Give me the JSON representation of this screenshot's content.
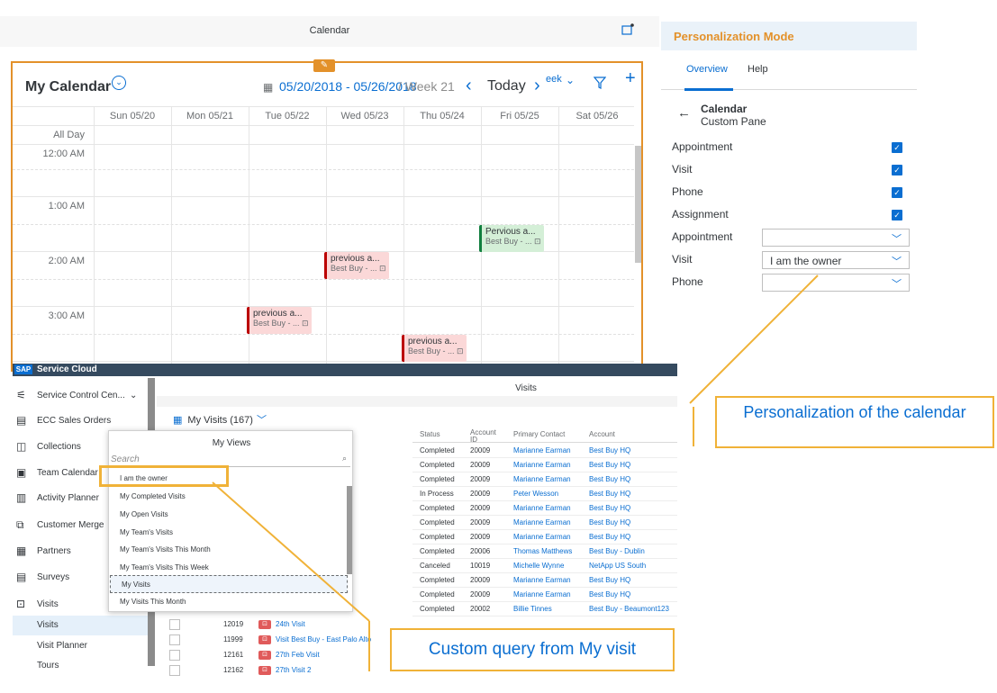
{
  "calendar": {
    "window_title": "Calendar",
    "title": "My Calendar",
    "range": "05/20/2018 - 05/26/2018",
    "week": "/ Week 21",
    "today_label": "Today",
    "view_fragment": "eek",
    "days": [
      "Sun 05/20",
      "Mon 05/21",
      "Tue 05/22",
      "Wed 05/23",
      "Thu 05/24",
      "Fri 05/25",
      "Sat 05/26"
    ],
    "all_day_label": "All Day",
    "times": [
      "12:00 AM",
      "1:00 AM",
      "2:00 AM",
      "3:00 AM"
    ],
    "appointments": [
      {
        "title": "Pervious a...",
        "sub": "Best Buy - ...",
        "color": "green"
      },
      {
        "title": "previous a...",
        "sub": "Best Buy - ...",
        "color": "red"
      },
      {
        "title": "previous a...",
        "sub": "Best Buy - ...",
        "color": "red"
      },
      {
        "title": "previous a...",
        "sub": "Best Buy - ...",
        "color": "red"
      }
    ]
  },
  "personalization": {
    "header": "Personalization Mode",
    "tabs": [
      "Overview",
      "Help"
    ],
    "section_title": "Calendar",
    "section_subtitle": "Custom Pane",
    "checkboxes": [
      "Appointment",
      "Visit",
      "Phone",
      "Assignment"
    ],
    "selects": [
      {
        "label": "Appointment",
        "value": ""
      },
      {
        "label": "Visit",
        "value": "I am the owner"
      },
      {
        "label": "Phone",
        "value": ""
      }
    ]
  },
  "annotations": {
    "personalization": "Personalization of the calendar",
    "query": "Custom query from My visit"
  },
  "service_cloud": {
    "logo": "SAP",
    "product": "Service Cloud",
    "page_title": "Visits",
    "sidebar": [
      "Service Control Cen...",
      "ECC Sales Orders",
      "Collections",
      "Team Calendar",
      "Activity Planner",
      "Customer Merge",
      "Partners",
      "Surveys",
      "Visits"
    ],
    "sidebar_sub": [
      "Visits",
      "Visit Planner",
      "Tours"
    ],
    "view_title": "My Visits (167)",
    "table_headers": [
      "Status",
      "Account ID",
      "Primary Contact",
      "Account"
    ],
    "rows": [
      {
        "status": "Completed",
        "id": "20009",
        "contact": "Marianne Earman",
        "account": "Best Buy HQ"
      },
      {
        "status": "Completed",
        "id": "20009",
        "contact": "Marianne Earman",
        "account": "Best Buy HQ"
      },
      {
        "status": "Completed",
        "id": "20009",
        "contact": "Marianne Earman",
        "account": "Best Buy HQ"
      },
      {
        "status": "In Process",
        "id": "20009",
        "contact": "Peter Wesson",
        "account": "Best Buy HQ"
      },
      {
        "status": "Completed",
        "id": "20009",
        "contact": "Marianne Earman",
        "account": "Best Buy HQ"
      },
      {
        "status": "Completed",
        "id": "20009",
        "contact": "Marianne Earman",
        "account": "Best Buy HQ"
      },
      {
        "status": "Completed",
        "id": "20009",
        "contact": "Marianne Earman",
        "account": "Best Buy HQ"
      },
      {
        "status": "Completed",
        "id": "20006",
        "contact": "Thomas Matthews",
        "account": "Best Buy - Dublin"
      },
      {
        "status": "Canceled",
        "id": "10019",
        "contact": "Michelle Wynne",
        "account": "NetApp US South"
      },
      {
        "status": "Completed",
        "id": "20009",
        "contact": "Marianne Earman",
        "account": "Best Buy HQ"
      },
      {
        "status": "Completed",
        "id": "20009",
        "contact": "Marianne Earman",
        "account": "Best Buy HQ"
      },
      {
        "status": "Completed",
        "id": "20002",
        "contact": "Billie Tinnes",
        "account": "Best Buy - Beaumont123"
      }
    ],
    "lower_rows": [
      {
        "id": "12019",
        "name": "24th Visit"
      },
      {
        "id": "11999",
        "name": "Visit Best Buy - East Palo Alto"
      },
      {
        "id": "12161",
        "name": "27th Feb Visit"
      },
      {
        "id": "12162",
        "name": "27th Visit 2"
      }
    ],
    "my_views": {
      "title": "My Views",
      "search_placeholder": "Search",
      "items": [
        "I am the owner",
        "My Completed Visits",
        "My Open Visits",
        "My Team's Visits",
        "My Team's Visits This Month",
        "My Team's Visits This Week",
        "My Visits",
        "My Visits This Month"
      ],
      "selected": "My Visits"
    }
  },
  "colors": {
    "accent": "#0a6ed1",
    "highlight": "#f0b238",
    "frame": "#e3912a",
    "shell": "#354a5f"
  }
}
